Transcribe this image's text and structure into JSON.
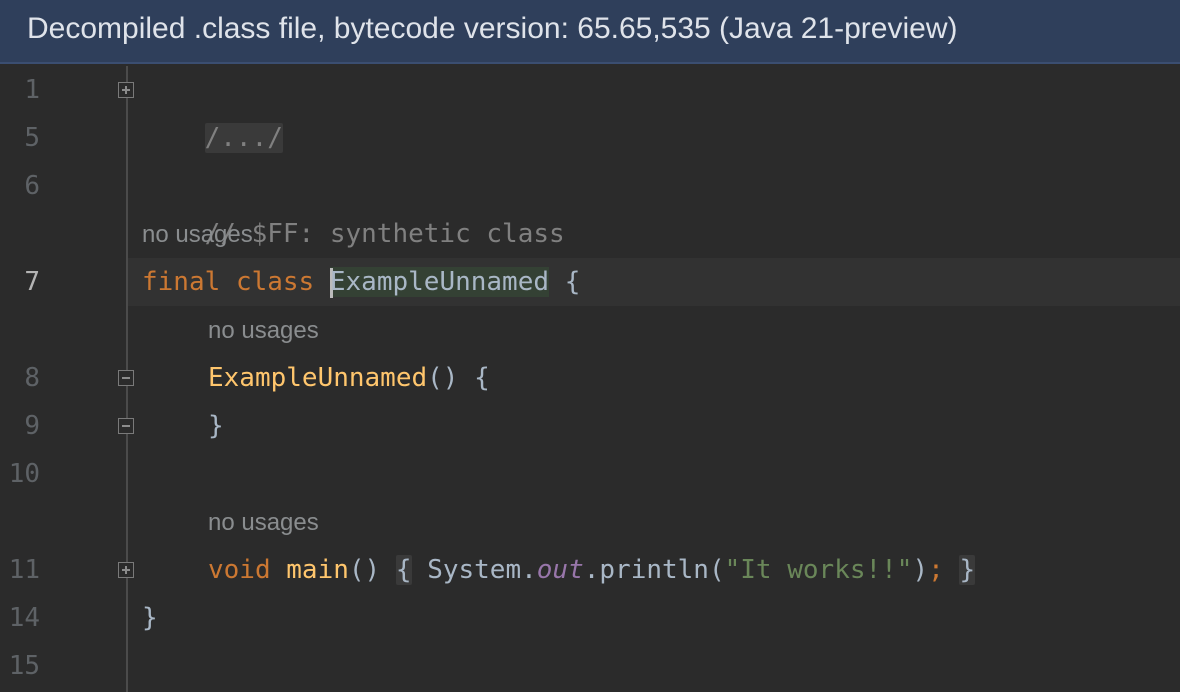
{
  "banner": {
    "text": "Decompiled .class file, bytecode version: 65.65,535 (Java 21-preview)"
  },
  "colors": {
    "background": "#2b2b2b",
    "banner_bg": "#2f3f5b",
    "keyword": "#cc7832",
    "function": "#ffc66d",
    "string": "#6a8759",
    "comment": "#808080",
    "static_field": "#9876aa"
  },
  "line_numbers": [
    "1",
    "5",
    "6",
    "7",
    "8",
    "9",
    "10",
    "11",
    "14",
    "15"
  ],
  "code": {
    "line1": {
      "folded_import": "/.../"
    },
    "line6": {
      "comment": "// $FF: synthetic class"
    },
    "hint_class": "no usages",
    "line7": {
      "kw_final": "final",
      "kw_class": "class",
      "class_name": "ExampleUnnamed",
      "brace_open": "{"
    },
    "hint_ctor": "no usages",
    "line8": {
      "ctor_name": "ExampleUnnamed",
      "params": "()",
      "brace_open": "{"
    },
    "line9": {
      "brace_close": "}"
    },
    "hint_main": "no usages",
    "line11": {
      "kw_void": "void",
      "method_name": "main",
      "params": "()",
      "brace_open": "{",
      "receiver": "System.",
      "field": "out",
      "call": ".println(",
      "string_literal": "\"It works!!\"",
      "call_close": ")",
      "semicolon": ";",
      "brace_close": "}"
    },
    "line14": {
      "brace_close": "}"
    }
  }
}
